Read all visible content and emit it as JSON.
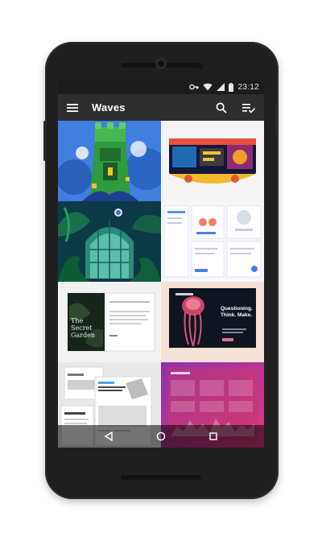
{
  "status_bar": {
    "time": "23:12"
  },
  "app_bar": {
    "title": "Waves"
  },
  "tiles": [
    {
      "name": "green-castle-illustration"
    },
    {
      "name": "delorean-car-illustration"
    },
    {
      "name": "jungle-greenhouse-illustration"
    },
    {
      "name": "medical-dashboard-ui"
    },
    {
      "name": "secret-garden-web-layout",
      "text": "The Secret Garden"
    },
    {
      "name": "jellyfish-landing-page",
      "headline": "Questioning. Think. Make."
    },
    {
      "name": "new-generation-web-layout"
    },
    {
      "name": "purple-analytics-dashboard"
    }
  ],
  "colors": {
    "appbar": "#2e2e2e",
    "statusbar": "#1c1c1c",
    "phone": "#1f1f1f"
  }
}
